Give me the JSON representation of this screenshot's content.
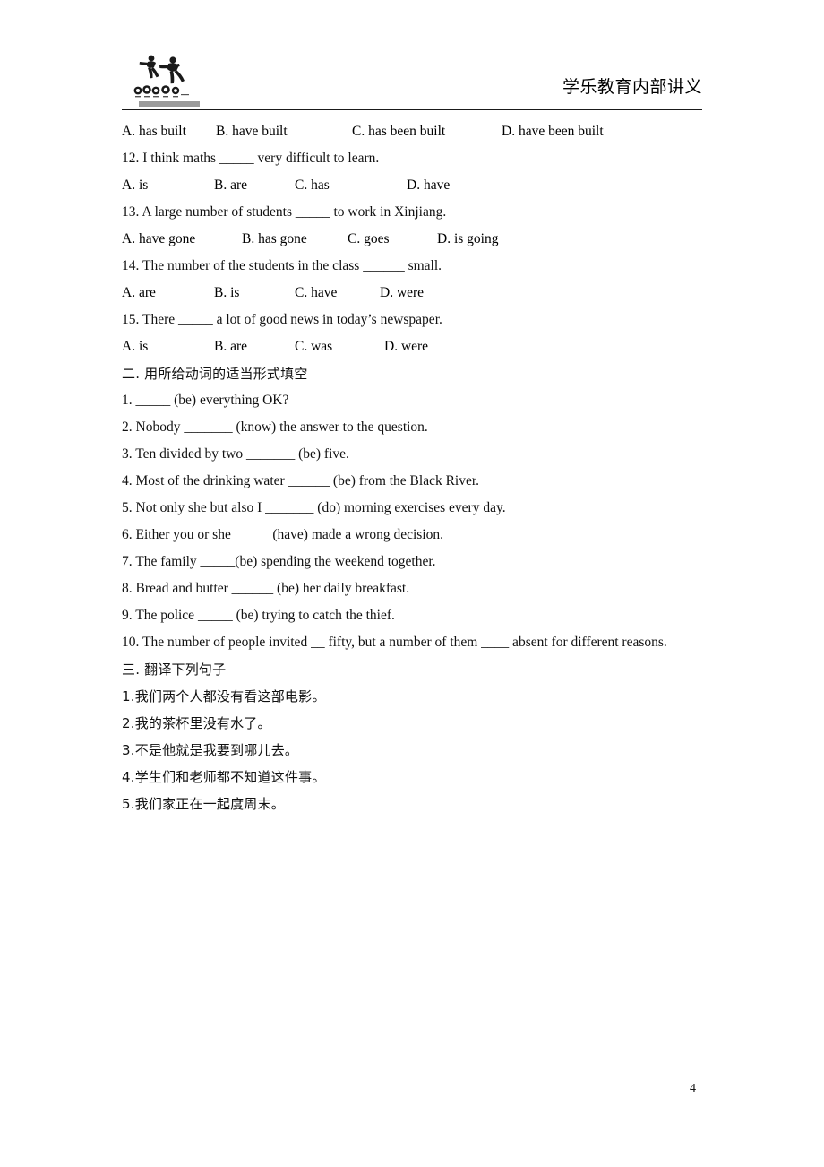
{
  "header": {
    "title": "学乐教育内部讲义",
    "logo_name": "xuele-education-logo"
  },
  "content": {
    "q11_options": {
      "a": "A. has built",
      "b": "B. have built",
      "c": "C. has been built",
      "d": "D. have been built"
    },
    "q12": "12. I think maths _____ very difficult to learn.",
    "q12_options": {
      "a": "A. is",
      "b": "B. are",
      "c": "C. has",
      "d": "D. have"
    },
    "q13": "13. A large number of students _____ to work in Xinjiang.",
    "q13_options": {
      "a": "A. have gone",
      "b": "B. has gone",
      "c": "C. goes",
      "d": "D. is going"
    },
    "q14": "14. The number of the students in the class ______ small.",
    "q14_options": {
      "a": "A. are",
      "b": "B. is",
      "c": "C. have",
      "d": "D. were"
    },
    "q15": "15. There _____ a lot of good news in today’s newspaper.",
    "q15_options": {
      "a": "A. is",
      "b": "B. are",
      "c": "C. was",
      "d": "D. were"
    },
    "section_two_heading": "二. 用所给动词的适当形式填空",
    "fill_items": [
      "1. _____ (be) everything OK?",
      "2. Nobody _______ (know) the answer to the question.",
      "3. Ten divided by two _______ (be) five.",
      "4. Most of the drinking water ______ (be) from the Black River.",
      "5. Not only she but also I _______ (do) morning exercises every day.",
      "6. Either you or she _____ (have) made a wrong decision.",
      "7. The family _____(be) spending the weekend together.",
      "8. Bread and butter ______ (be) her daily breakfast.",
      "9. The police _____ (be) trying to catch the thief.",
      "10. The number of people invited __ fifty, but a number of them ____ absent for different reasons."
    ],
    "section_three_heading": "三. 翻译下列句子",
    "translate_items": [
      "1.我们两个人都没有看这部电影。",
      "2.我的茶杯里没有水了。",
      "3.不是他就是我要到哪儿去。",
      "4.学生们和老师都不知道这件事。",
      "5.我们家正在一起度周末。"
    ]
  },
  "footer": {
    "page_number": "4"
  }
}
